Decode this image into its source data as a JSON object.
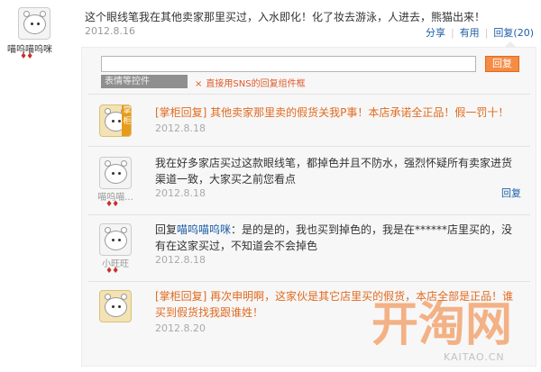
{
  "top_post": {
    "username": "喵呜喵呜咪",
    "hearts": "♦♦",
    "comment": "这个眼线笔我在其他卖家那里买过，入水即化！化了妆去游泳，人进去，熊猫出来！",
    "date": "2012.8.16",
    "actions": {
      "share": "分享",
      "useful": "有用",
      "reply": "回复(20)"
    }
  },
  "reply_form": {
    "submit_label": "回复",
    "emoji_tab": "表情等控件",
    "note_icon": "×",
    "note": "直接用SNS的回复组件框"
  },
  "replies": [
    {
      "username": "",
      "seller_badge": "掌柜",
      "text": "[掌柜回复] 其他卖家那里卖的假货关我P事！本店承诺全正品！假一罚十！",
      "date": "2012.8.18"
    },
    {
      "username": "喵呜喵...",
      "hearts": "♦♦",
      "text": "我在好多家店买过这款眼线笔，都掉色并且不防水，强烈怀疑所有卖家进货渠道一致，大家买之前您看点",
      "date": "2012.8.18",
      "reply_label": "回复"
    },
    {
      "username": "小旺旺",
      "hearts": "♦♦",
      "prefix": "回复",
      "mention": "喵呜喵呜咪",
      "text": "：是的是的，我也买到掉色的，我是在******店里买的，没有在这家买过，不知道会不会掉色",
      "date": "2012.8.18"
    },
    {
      "username": "",
      "text": "[掌柜回复] 再次申明啊，这家伙是其它店里买的假货，本店全部是正品！谁买到假货找我跟谁姓！",
      "date": "2012.8.20"
    }
  ],
  "watermark": {
    "big": "开淘网",
    "small": "KAITAO.CN"
  }
}
